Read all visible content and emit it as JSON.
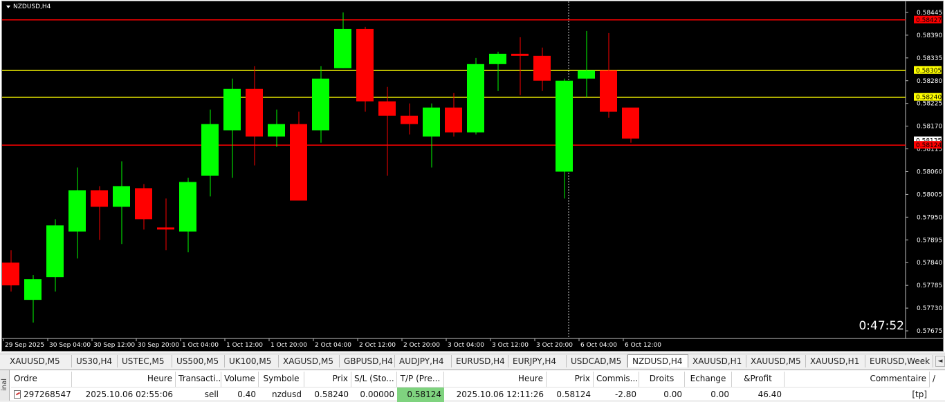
{
  "chart": {
    "symbol_label": "NZDUSD,H4",
    "countdown": "0:47:52",
    "background": "#000000",
    "bull_color": "#00ff00",
    "bear_color": "#ff0000",
    "price_axis": {
      "ticks": [
        "0.58445",
        "0.58390",
        "0.58335",
        "0.58280",
        "0.58225",
        "0.58170",
        "0.58115",
        "0.58060",
        "0.58005",
        "0.57950",
        "0.57895",
        "0.57840",
        "0.57785",
        "0.57730",
        "0.57675"
      ]
    },
    "time_axis": {
      "labels": [
        "29 Sep 2025",
        "30 Sep 04:00",
        "30 Sep 12:00",
        "30 Sep 20:00",
        "1 Oct 04:00",
        "1 Oct 12:00",
        "1 Oct 20:00",
        "2 Oct 04:00",
        "2 Oct 12:00",
        "2 Oct 20:00",
        "3 Oct 04:00",
        "3 Oct 12:00",
        "3 Oct 20:00",
        "6 Oct 04:00",
        "6 Oct 12:00"
      ]
    },
    "horizontal_lines": [
      {
        "price": 0.58427,
        "color": "#ff0000",
        "label": "0.58427"
      },
      {
        "price": 0.58305,
        "color": "#ffff00",
        "label": "0.58305"
      },
      {
        "price": 0.5824,
        "color": "#ffff00",
        "label": "0.58240"
      },
      {
        "price": 0.58124,
        "color": "#ff0000",
        "label": "0.58124"
      }
    ],
    "current_price_label": "0.58135",
    "current_price": 0.58135,
    "crosshair_time_index": 25,
    "price_range": [
      0.5766,
      0.58465
    ]
  },
  "chart_data": {
    "type": "candlestick",
    "title": "NZDUSD,H4",
    "candles": [
      {
        "o": 0.5784,
        "h": 0.5787,
        "l": 0.5777,
        "c": 0.57785
      },
      {
        "o": 0.5775,
        "h": 0.5781,
        "l": 0.57695,
        "c": 0.578
      },
      {
        "o": 0.57805,
        "h": 0.57945,
        "l": 0.5777,
        "c": 0.5793
      },
      {
        "o": 0.57915,
        "h": 0.5807,
        "l": 0.5785,
        "c": 0.58015
      },
      {
        "o": 0.58015,
        "h": 0.58025,
        "l": 0.57895,
        "c": 0.57975
      },
      {
        "o": 0.57975,
        "h": 0.58085,
        "l": 0.57885,
        "c": 0.58025
      },
      {
        "o": 0.5802,
        "h": 0.5803,
        "l": 0.5792,
        "c": 0.57945
      },
      {
        "o": 0.57925,
        "h": 0.57995,
        "l": 0.5787,
        "c": 0.5792
      },
      {
        "o": 0.57915,
        "h": 0.58045,
        "l": 0.57865,
        "c": 0.58035
      },
      {
        "o": 0.5805,
        "h": 0.5821,
        "l": 0.58,
        "c": 0.58175
      },
      {
        "o": 0.5816,
        "h": 0.58285,
        "l": 0.58045,
        "c": 0.5826
      },
      {
        "o": 0.5826,
        "h": 0.58315,
        "l": 0.58075,
        "c": 0.58145
      },
      {
        "o": 0.58145,
        "h": 0.5821,
        "l": 0.5812,
        "c": 0.58175
      },
      {
        "o": 0.58175,
        "h": 0.58205,
        "l": 0.58025,
        "c": 0.5799
      },
      {
        "o": 0.5816,
        "h": 0.58315,
        "l": 0.5813,
        "c": 0.58285
      },
      {
        "o": 0.5831,
        "h": 0.58445,
        "l": 0.5831,
        "c": 0.58405
      },
      {
        "o": 0.58405,
        "h": 0.5841,
        "l": 0.58205,
        "c": 0.5823
      },
      {
        "o": 0.5823,
        "h": 0.58265,
        "l": 0.5805,
        "c": 0.58195
      },
      {
        "o": 0.58195,
        "h": 0.58225,
        "l": 0.5815,
        "c": 0.58175
      },
      {
        "o": 0.58145,
        "h": 0.58225,
        "l": 0.5807,
        "c": 0.58215
      },
      {
        "o": 0.58215,
        "h": 0.5825,
        "l": 0.58145,
        "c": 0.58155
      },
      {
        "o": 0.58155,
        "h": 0.58335,
        "l": 0.5815,
        "c": 0.5832
      },
      {
        "o": 0.5832,
        "h": 0.5835,
        "l": 0.58255,
        "c": 0.58345
      },
      {
        "o": 0.58345,
        "h": 0.58385,
        "l": 0.58245,
        "c": 0.5834
      },
      {
        "o": 0.5834,
        "h": 0.5836,
        "l": 0.58255,
        "c": 0.5828
      },
      {
        "o": 0.5806,
        "h": 0.58285,
        "l": 0.57995,
        "c": 0.5828
      },
      {
        "o": 0.58285,
        "h": 0.584,
        "l": 0.5824,
        "c": 0.58305
      },
      {
        "o": 0.58305,
        "h": 0.58395,
        "l": 0.5819,
        "c": 0.58205
      },
      {
        "o": 0.58215,
        "h": 0.5821,
        "l": 0.5813,
        "c": 0.5814
      }
    ]
  },
  "tabs": {
    "items": [
      "XAUUSD,M5",
      "US30,H4",
      "USTEC,M5",
      "US500,M5",
      "UK100,M5",
      "XAGUSD,M5",
      "GBPUSD,H4",
      "AUDJPY,H4",
      "EURUSD,H4",
      "EURJPY,H4",
      "USDCAD,M5",
      "NZDUSD,H4",
      "XAUUSD,H1",
      "XAUUSD,M5",
      "XAUUSD,H1",
      "EURUSD,Week"
    ],
    "active_index": 11
  },
  "terminal": {
    "side_label": "inal",
    "headers": [
      "Ordre",
      "Heure",
      "Transacti...",
      "Volume",
      "Symbole",
      "Prix",
      "S/L (Sto...",
      "T/P (Pre...",
      "Heure",
      "Prix",
      "Commis...",
      "Droits",
      "Echange",
      "&Profit",
      "Commentaire"
    ],
    "row": [
      "297268547",
      "2025.10.06 02:55:06",
      "sell",
      "0.40",
      "nzdusd",
      "0.58240",
      "0.00000",
      "0.58124",
      "2025.10.06 12:11:26",
      "0.58124",
      "-2.80",
      "0.00",
      "0.00",
      "46.40",
      "[tp]"
    ]
  }
}
